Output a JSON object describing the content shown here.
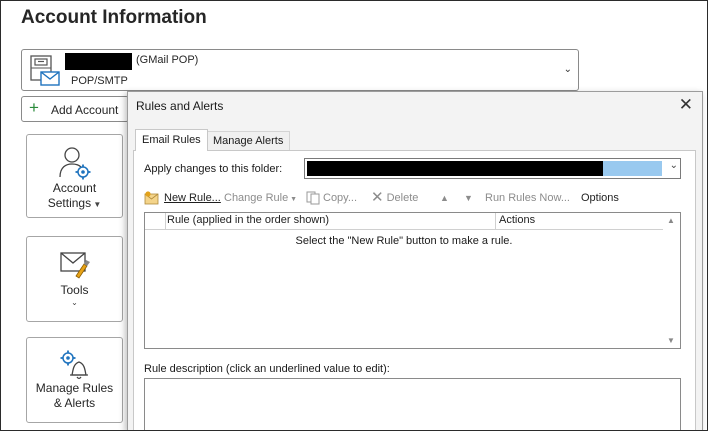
{
  "backstage": {
    "title": "Account Information",
    "account": {
      "type": "(GMail POP)",
      "protocol": "POP/SMTP"
    },
    "add_account_label": "Add Account",
    "tiles": [
      {
        "label_line1": "Account",
        "label_line2": "Settings",
        "has_chevron": true,
        "icon": "account-settings-icon"
      },
      {
        "label_line1": "Tools",
        "label_line2": "",
        "has_chevron": true,
        "icon": "tools-icon"
      },
      {
        "label_line1": "Manage Rules",
        "label_line2": "& Alerts",
        "has_chevron": false,
        "icon": "manage-rules-icon"
      }
    ]
  },
  "dialog": {
    "title": "Rules and Alerts",
    "tabs": [
      {
        "label": "Email Rules",
        "active": true
      },
      {
        "label": "Manage Alerts",
        "active": false
      }
    ],
    "apply_label": "Apply changes to this folder:",
    "toolbar": {
      "new_rule": "New Rule...",
      "change_rule": "Change Rule",
      "copy": "Copy...",
      "delete": "Delete",
      "run_rules": "Run Rules Now...",
      "options": "Options"
    },
    "rules_list": {
      "col_rule": "Rule (applied in the order shown)",
      "col_actions": "Actions",
      "empty_message": "Select the \"New Rule\" button to make a rule."
    },
    "description_label": "Rule description (click an underlined value to edit):"
  },
  "colors": {
    "accent": "#1e73be",
    "selection": "#99c9ef",
    "disabled_text": "#8c8c8c"
  }
}
